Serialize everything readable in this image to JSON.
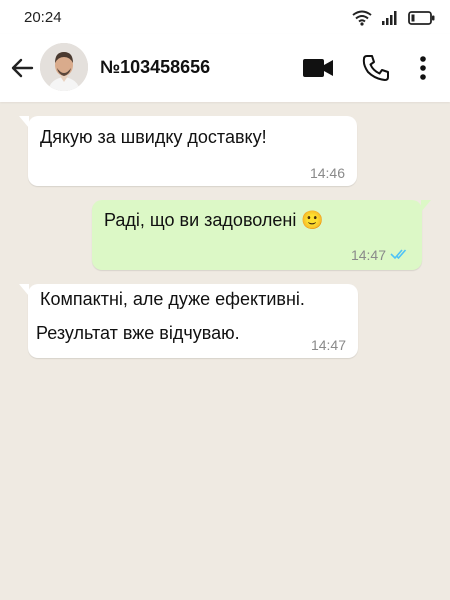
{
  "status_bar": {
    "time": "20:24",
    "icons": [
      "wifi-icon",
      "signal-icon",
      "battery-icon"
    ]
  },
  "header": {
    "back_icon": "arrow-left-icon",
    "contact_name": "№103458656",
    "actions": [
      "video-call-icon",
      "phone-icon",
      "more-vertical-icon"
    ]
  },
  "colors": {
    "chat_background": "#efeae2",
    "incoming_bubble": "#ffffff",
    "outgoing_bubble": "#dcf8c6",
    "read_ticks": "#4fc3f7"
  },
  "messages": [
    {
      "direction": "incoming",
      "lines": [
        "Дякую за швидку доставку!"
      ],
      "time": "14:46"
    },
    {
      "direction": "outgoing",
      "lines": [
        "Раді, що ви задоволені 🙂"
      ],
      "time": "14:47",
      "status": "read-double-tick-icon"
    },
    {
      "direction": "incoming",
      "lines": [
        "Компактні, але дуже ефективні.",
        "Результат вже відчуваю."
      ],
      "time": "14:47"
    }
  ]
}
